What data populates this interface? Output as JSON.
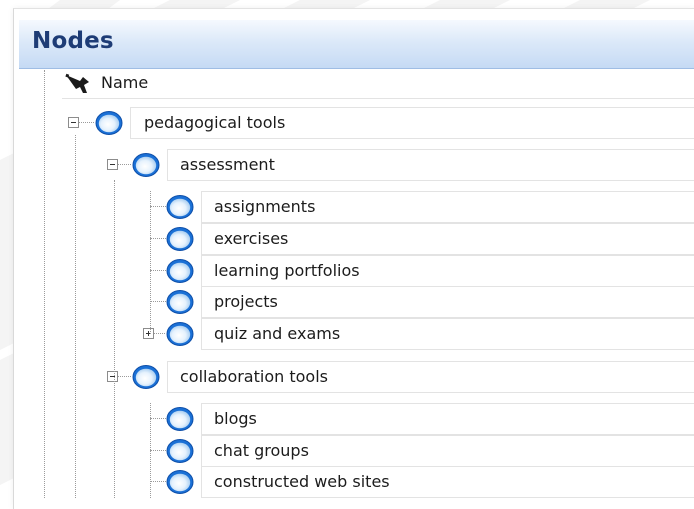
{
  "panel": {
    "title": "Nodes",
    "column_header": "Name",
    "header_icon": "pushpin-icon",
    "node_icon": "blue-circle-icon",
    "expander_expanded": "minus-box-icon",
    "expander_collapsed": "plus-box-icon",
    "accent_color": "#1e3c76",
    "title_bar_color": "#c5daf4"
  },
  "tree": [
    {
      "label": "pedagogical tools",
      "level": 0,
      "expander": "expanded"
    },
    {
      "label": "assessment",
      "level": 1,
      "expander": "expanded"
    },
    {
      "label": "assignments",
      "level": 2,
      "expander": "none"
    },
    {
      "label": "exercises",
      "level": 2,
      "expander": "none"
    },
    {
      "label": "learning portfolios",
      "level": 2,
      "expander": "none"
    },
    {
      "label": "projects",
      "level": 2,
      "expander": "none"
    },
    {
      "label": "quiz and exams",
      "level": 2,
      "expander": "collapsed"
    },
    {
      "label": "collaboration tools",
      "level": 1,
      "expander": "expanded"
    },
    {
      "label": "blogs",
      "level": 2,
      "expander": "none"
    },
    {
      "label": "chat groups",
      "level": 2,
      "expander": "none"
    },
    {
      "label": "constructed web sites",
      "level": 2,
      "expander": "none"
    }
  ]
}
